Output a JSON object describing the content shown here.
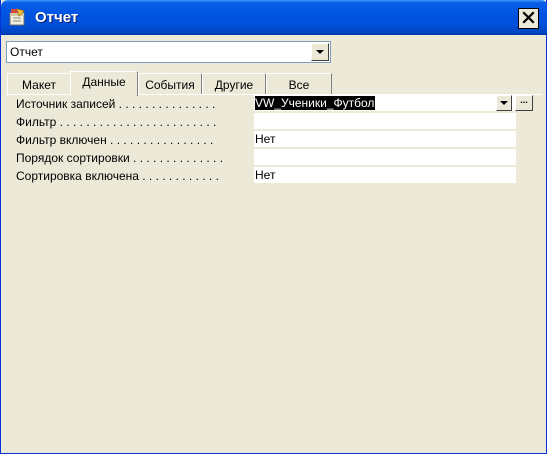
{
  "window": {
    "title": "Отчет"
  },
  "object_selector": {
    "value": "Отчет"
  },
  "tabs": [
    {
      "label": "Макет",
      "active": false
    },
    {
      "label": "Данные",
      "active": true
    },
    {
      "label": "События",
      "active": false
    },
    {
      "label": "Другие",
      "active": false
    },
    {
      "label": "Все",
      "active": false
    }
  ],
  "properties": [
    {
      "label": "Источник записей",
      "dots": " . . . . . . . . . . . . . . .",
      "value": "VW_Ученики_Футбол",
      "selected": true
    },
    {
      "label": "Фильтр",
      "dots": " . . . . . . . . . . . . . . . . . . . . . . . .",
      "value": ""
    },
    {
      "label": "Фильтр включен",
      "dots": " . . . . . . . . . . . . . . . .",
      "value": "Нет"
    },
    {
      "label": "Порядок сортировки",
      "dots": " . . . . . . . . . . . . . .",
      "value": ""
    },
    {
      "label": "Сортировка включена",
      "dots": " . . . . . . . . . . . .",
      "value": "Нет"
    }
  ],
  "build_button": {
    "label": "..."
  },
  "colors": {
    "titlebar": "#0054e3",
    "dialog_bg": "#ece9d8",
    "selection": "#000000"
  },
  "icons": {
    "app": "properties-window-icon",
    "close": "close-icon",
    "dropdown": "chevron-down-icon"
  }
}
